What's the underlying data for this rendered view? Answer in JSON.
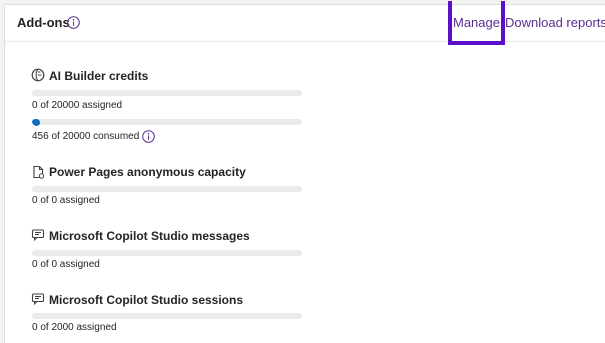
{
  "header": {
    "title": "Add-ons",
    "manage_label": "Manage",
    "download_label": "Download reports"
  },
  "colors": {
    "accent": "#5c2e91",
    "highlight_border": "#5b0fc9",
    "progress_fill": "#0f6cbd",
    "track": "#edebe9"
  },
  "sections": [
    {
      "title": "AI Builder credits",
      "icon": "ai-builder-icon",
      "assigned_text": "0 of 20000 assigned",
      "assigned_fraction": 0,
      "consumed_text": "456 of 20000 consumed",
      "consumed_fraction": 0.0228
    },
    {
      "title": "Power Pages anonymous capacity",
      "icon": "document-page-icon",
      "assigned_text": "0 of 0 assigned",
      "assigned_fraction": 0
    },
    {
      "title": "Microsoft Copilot Studio messages",
      "icon": "chat-icon",
      "assigned_text": "0 of 0 assigned",
      "assigned_fraction": 0
    },
    {
      "title": "Microsoft Copilot Studio sessions",
      "icon": "chat-icon",
      "assigned_text": "0 of 2000 assigned",
      "assigned_fraction": 0
    }
  ]
}
